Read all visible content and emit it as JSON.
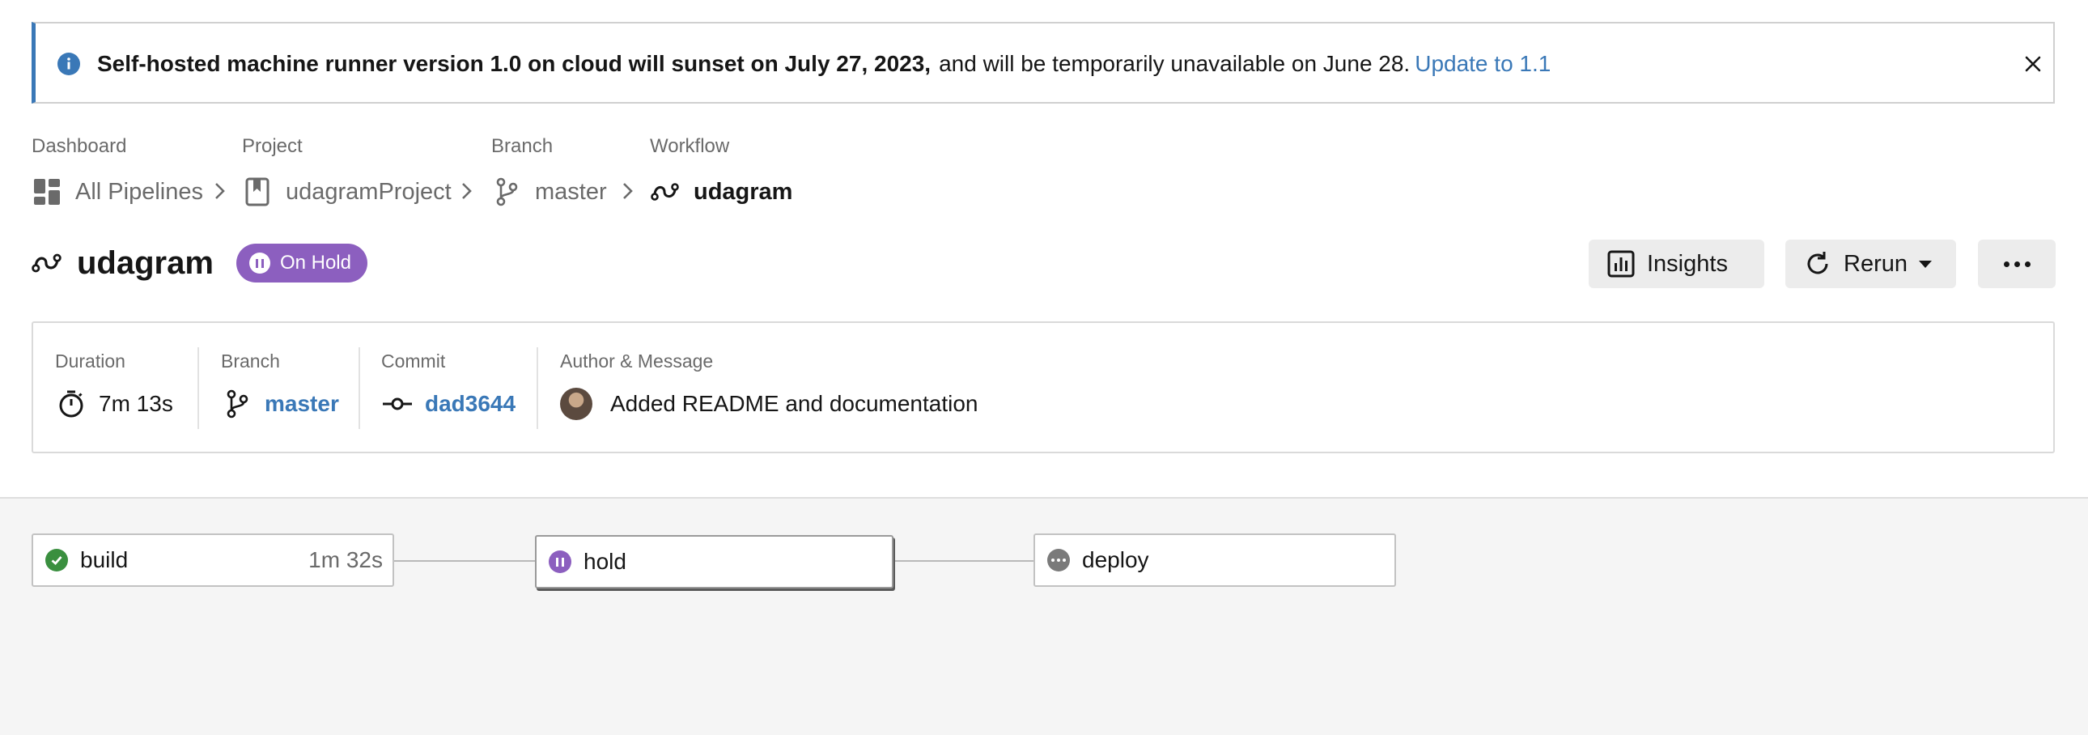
{
  "banner": {
    "bold_text": "Self-hosted machine runner version 1.0 on cloud will sunset on July 27, 2023,",
    "rest_text": "and will be temporarily unavailable on June 28.",
    "link_text": "Update to 1.1",
    "icon": "info-icon",
    "close_icon": "close-icon"
  },
  "breadcrumb": [
    {
      "label": "Dashboard",
      "value": "All Pipelines",
      "icon": "dashboard-icon"
    },
    {
      "label": "Project",
      "value": "udagramProject",
      "icon": "bookmark-icon"
    },
    {
      "label": "Branch",
      "value": "master",
      "icon": "branch-icon"
    },
    {
      "label": "Workflow",
      "value": "udagram",
      "icon": "workflow-icon"
    }
  ],
  "header": {
    "title": "udagram",
    "status": "On Hold",
    "status_color": "#8c5fbf",
    "buttons": {
      "insights": "Insights",
      "rerun": "Rerun"
    }
  },
  "summary": {
    "duration": {
      "label": "Duration",
      "value": "7m 13s"
    },
    "branch": {
      "label": "Branch",
      "value": "master"
    },
    "commit": {
      "label": "Commit",
      "value": "dad3644"
    },
    "author": {
      "label": "Author & Message",
      "message": "Added README and documentation"
    }
  },
  "jobs": [
    {
      "name": "build",
      "status": "success",
      "duration": "1m 32s",
      "status_color": "#3a8f3f"
    },
    {
      "name": "hold",
      "status": "on-hold",
      "duration": "",
      "status_color": "#8c5fbf"
    },
    {
      "name": "deploy",
      "status": "blocked",
      "duration": "",
      "status_color": "#7a7a7a"
    }
  ],
  "colors": {
    "accent": "#3a78b7",
    "banner_border": "#3a78b7"
  }
}
